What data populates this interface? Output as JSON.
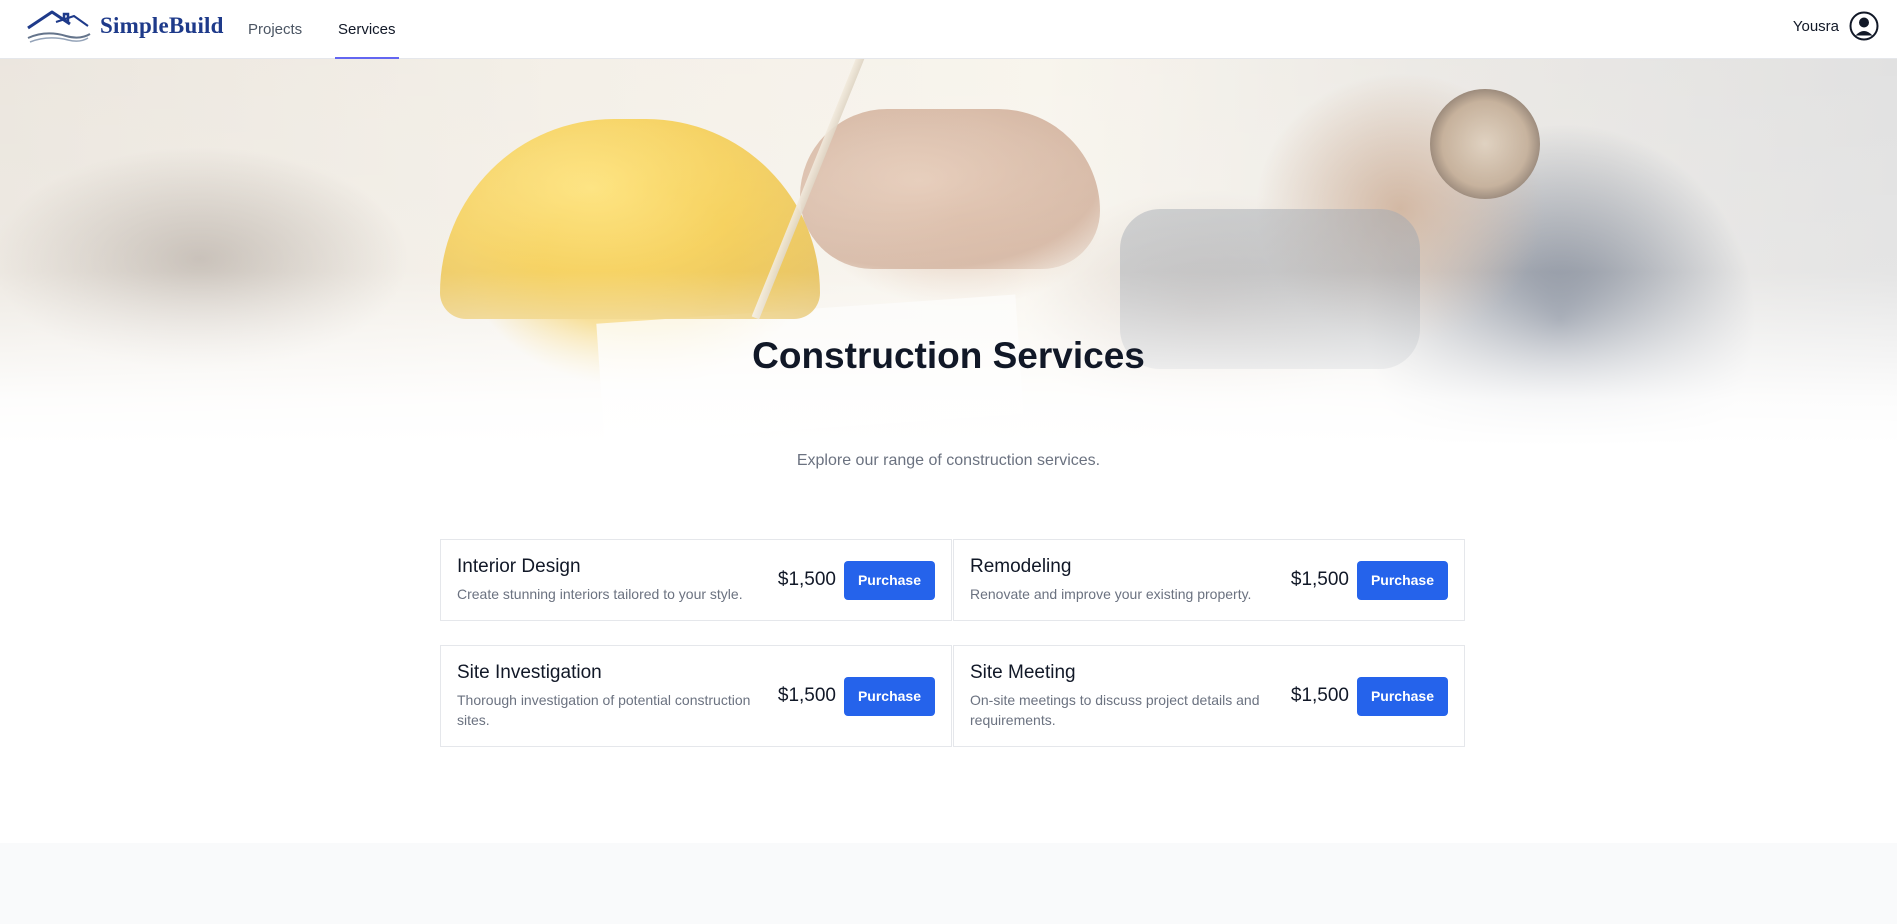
{
  "brand": {
    "name": "SimpleBuild",
    "logo_icon": "house-roof-logo-icon"
  },
  "nav": {
    "items": [
      {
        "label": "Projects",
        "active": false
      },
      {
        "label": "Services",
        "active": true
      }
    ],
    "accent_color": "#6366f1"
  },
  "user": {
    "name": "Yousra",
    "icon": "user-circle-icon"
  },
  "hero": {
    "title": "Construction Services",
    "subtitle": "Explore our range of construction services."
  },
  "services": [
    {
      "title": "Interior Design",
      "description": "Create stunning interiors tailored to your style.",
      "price": "$1,500",
      "button": "Purchase"
    },
    {
      "title": "Remodeling",
      "description": "Renovate and improve your existing property.",
      "price": "$1,500",
      "button": "Purchase"
    },
    {
      "title": "Site Investigation",
      "description": "Thorough investigation of potential construction sites.",
      "price": "$1,500",
      "button": "Purchase"
    },
    {
      "title": "Site Meeting",
      "description": "On-site meetings to discuss project details and requirements.",
      "price": "$1,500",
      "button": "Purchase"
    }
  ],
  "colors": {
    "primary_button": "#2563eb",
    "brand": "#1e3a8a"
  }
}
